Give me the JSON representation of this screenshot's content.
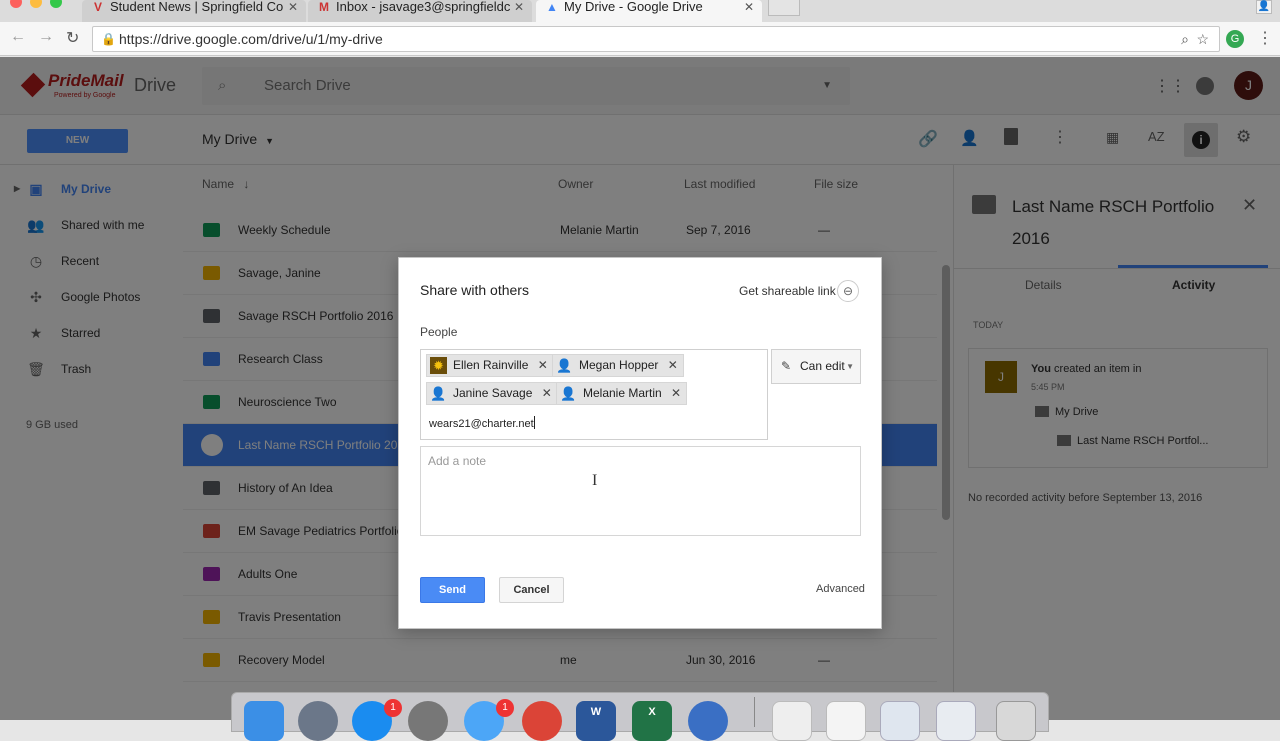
{
  "browser": {
    "tabs": [
      {
        "title": "Student News | Springfield Co",
        "icon": "v-icon"
      },
      {
        "title": "Inbox - jsavage3@springfieldc",
        "icon": "gmail-icon"
      },
      {
        "title": "My Drive - Google Drive",
        "icon": "drive-icon"
      }
    ],
    "url": "https://drive.google.com/drive/u/1/my-drive",
    "profile_initial": "J"
  },
  "drive": {
    "logo_text": "PrideMail",
    "logo_sub": "Powered by Google",
    "product": "Drive",
    "search_placeholder": "Search Drive",
    "new_label": "NEW",
    "location_title": "My Drive",
    "account_initial": "J",
    "sidebar": [
      {
        "label": "My Drive",
        "icon": "drive-icon"
      },
      {
        "label": "Shared with me",
        "icon": "people-icon"
      },
      {
        "label": "Recent",
        "icon": "clock-icon"
      },
      {
        "label": "Google Photos",
        "icon": "pinwheel-icon"
      },
      {
        "label": "Starred",
        "icon": "star-icon"
      },
      {
        "label": "Trash",
        "icon": "trash-icon"
      }
    ],
    "storage": "9 GB used",
    "columns": {
      "name": "Name",
      "owner": "Owner",
      "modified": "Last modified",
      "size": "File size"
    },
    "rows": [
      {
        "name": "Weekly Schedule",
        "owner": "Melanie Martin",
        "modified": "Sep 7, 2016",
        "size": "—",
        "color": "#0f9d58"
      },
      {
        "name": "Savage, Janine",
        "owner": "",
        "modified": "",
        "size": "",
        "color": "#f4b400"
      },
      {
        "name": "Savage RSCH Portfolio 2016",
        "owner": "",
        "modified": "",
        "size": "",
        "color": "#5f6368"
      },
      {
        "name": "Research Class",
        "owner": "",
        "modified": "",
        "size": "",
        "color": "#4285f4"
      },
      {
        "name": "Neuroscience Two",
        "owner": "",
        "modified": "",
        "size": "",
        "color": "#0f9d58"
      },
      {
        "name": "Last Name RSCH Portfolio 20",
        "owner": "",
        "modified": "",
        "size": "",
        "color": "#ffffff"
      },
      {
        "name": "History of An Idea",
        "owner": "",
        "modified": "",
        "size": "",
        "color": "#5f6368"
      },
      {
        "name": "EM Savage Pediatrics Portfolio",
        "owner": "",
        "modified": "",
        "size": "",
        "color": "#db4437"
      },
      {
        "name": "Adults One",
        "owner": "",
        "modified": "",
        "size": "",
        "color": "#9c27b0"
      },
      {
        "name": "Travis Presentation",
        "owner": "",
        "modified": "",
        "size": "",
        "color": "#f4b400"
      },
      {
        "name": "Recovery Model",
        "owner": "me",
        "modified": "Jun 30, 2016",
        "size": "—",
        "color": "#f4b400"
      }
    ],
    "details": {
      "title": "Last Name RSCH Portfolio 2016",
      "tabs": [
        "Details",
        "Activity"
      ],
      "today": "TODAY",
      "activity_you": "You",
      "activity_text": "created an item in",
      "activity_time": "5:45 PM",
      "path1": "My Drive",
      "path2": "Last Name RSCH Portfol...",
      "no_activity": "No recorded activity before September 13, 2016"
    }
  },
  "dialog": {
    "title": "Share with others",
    "shareable_link": "Get shareable link",
    "people_label": "People",
    "chips": [
      "Ellen Rainville",
      "Megan Hopper",
      "Janine Savage",
      "Melanie Martin"
    ],
    "typed_value": "wears21@charter.net",
    "permission": "Can edit",
    "note_placeholder": "Add a note",
    "send_label": "Send",
    "cancel_label": "Cancel",
    "advanced_label": "Advanced"
  },
  "dock": {
    "badge_appstore": "1",
    "badge_messages": "1"
  }
}
